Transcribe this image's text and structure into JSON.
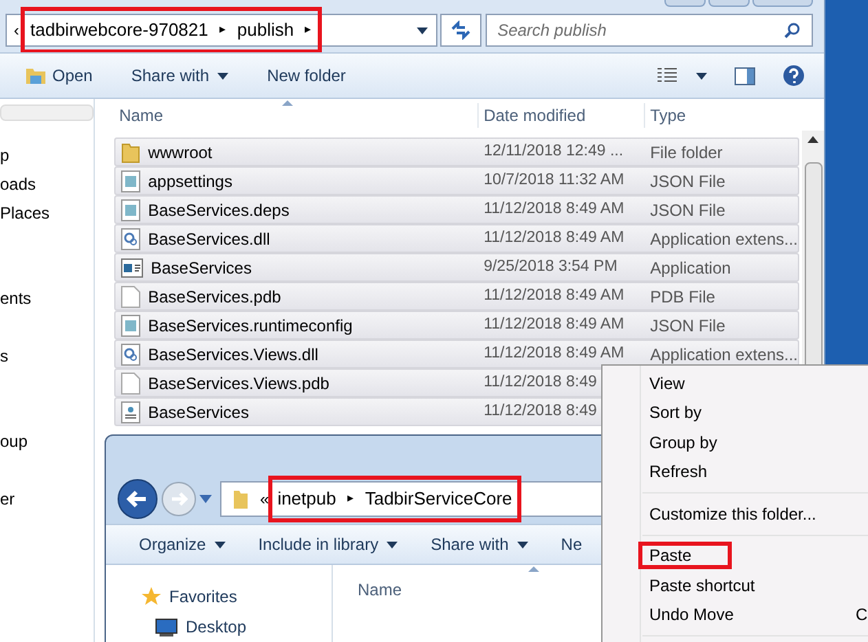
{
  "back_window": {
    "address_bar": {
      "overflow": "‹",
      "crumbs": [
        "tadbirwebcore-970821",
        "publish"
      ],
      "separator": "▸",
      "highlighted": true
    },
    "search": {
      "placeholder": "Search publish"
    },
    "toolbar": [
      {
        "label": "Open",
        "kind": "open"
      },
      {
        "label": "Share with",
        "kind": "menu"
      },
      {
        "label": "New folder",
        "kind": "plain"
      }
    ],
    "sidebar": {
      "items": [
        "p",
        "oads",
        "Places",
        "ents",
        "s",
        "oup",
        "er"
      ]
    },
    "columns": [
      "Name",
      "Date modified",
      "Type"
    ],
    "rows": [
      {
        "name": "wwwroot",
        "date": "12/11/2018 12:49 ...",
        "type": "File folder",
        "kind": "folder"
      },
      {
        "name": "appsettings",
        "date": "10/7/2018 11:32 AM",
        "type": "JSON File",
        "kind": "json"
      },
      {
        "name": "BaseServices.deps",
        "date": "11/12/2018 8:49 AM",
        "type": "JSON File",
        "kind": "json"
      },
      {
        "name": "BaseServices.dll",
        "date": "11/12/2018 8:49 AM",
        "type": "Application extens...",
        "kind": "dll"
      },
      {
        "name": "BaseServices",
        "date": "9/25/2018 3:54 PM",
        "type": "Application",
        "kind": "app"
      },
      {
        "name": "BaseServices.pdb",
        "date": "11/12/2018 8:49 AM",
        "type": "PDB File",
        "kind": "blank"
      },
      {
        "name": "BaseServices.runtimeconfig",
        "date": "11/12/2018 8:49 AM",
        "type": "JSON File",
        "kind": "json"
      },
      {
        "name": "BaseServices.Views.dll",
        "date": "11/12/2018 8:49 AM",
        "type": "Application extens...",
        "kind": "dll"
      },
      {
        "name": "BaseServices.Views.pdb",
        "date": "11/12/2018 8:49",
        "type": "",
        "kind": "blank"
      },
      {
        "name": "BaseServices",
        "date": "11/12/2018 8:49",
        "type": "",
        "kind": "setup"
      }
    ]
  },
  "front_window": {
    "address_bar": {
      "overflow": "«",
      "crumbs": [
        "inetpub",
        "TadbirServiceCore"
      ],
      "separator": "▸",
      "highlighted": true
    },
    "toolbar": [
      {
        "label": "Organize",
        "kind": "menu"
      },
      {
        "label": "Include in library",
        "kind": "menu"
      },
      {
        "label": "Share with",
        "kind": "menu"
      },
      {
        "label": "Ne",
        "kind": "plain"
      }
    ],
    "nav": [
      {
        "label": "Favorites",
        "kind": "star"
      },
      {
        "label": "Desktop",
        "kind": "desktop"
      }
    ],
    "columns": [
      "Name"
    ]
  },
  "context_menu": {
    "items": [
      {
        "label": "View",
        "highlighted": false
      },
      {
        "label": "Sort by",
        "highlighted": false
      },
      {
        "label": "Group by",
        "highlighted": false
      },
      {
        "label": "Refresh",
        "highlighted": false,
        "separator_after": true
      },
      {
        "label": "Customize this folder...",
        "highlighted": false,
        "separator_after": true
      },
      {
        "label": "Paste",
        "highlighted": true
      },
      {
        "label": "Paste shortcut",
        "highlighted": false
      },
      {
        "label": "Undo Move",
        "highlighted": false,
        "shortcut": "C",
        "separator_after": true
      }
    ]
  }
}
